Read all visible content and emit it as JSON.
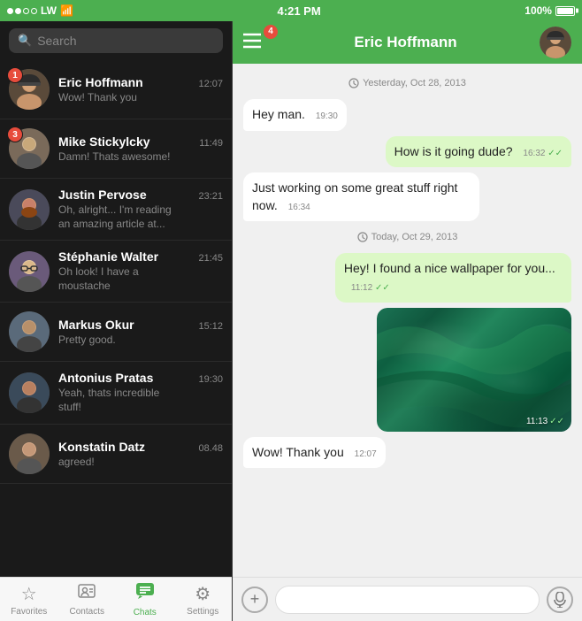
{
  "statusBar": {
    "carrier": "LW",
    "time": "4:21 PM",
    "battery": "100%"
  },
  "search": {
    "placeholder": "Search"
  },
  "chats": [
    {
      "id": 1,
      "name": "Eric Hoffmann",
      "time": "12:07",
      "preview": "Wow! Thank you",
      "badge": 1
    },
    {
      "id": 2,
      "name": "Mike Stickylcky",
      "time": "11:49",
      "preview": "Damn! Thats awesome!",
      "badge": 3
    },
    {
      "id": 3,
      "name": "Justin Pervose",
      "time": "23:21",
      "preview": "Oh, alright... I'm reading an amazing article at...",
      "badge": 0
    },
    {
      "id": 4,
      "name": "Stéphanie Walter",
      "time": "21:45",
      "preview": "Oh look! I have a moustache",
      "badge": 0
    },
    {
      "id": 5,
      "name": "Markus Okur",
      "time": "15:12",
      "preview": "Pretty good.",
      "badge": 0
    },
    {
      "id": 6,
      "name": "Antonius Pratas",
      "time": "19:30",
      "preview": "Yeah, thats incredible stuff!",
      "badge": 0
    },
    {
      "id": 7,
      "name": "Konstatin Datz",
      "time": "08.48",
      "preview": "agreed!",
      "badge": 0
    }
  ],
  "chatHeader": {
    "name": "Eric Hoffmann",
    "menuBadge": "4"
  },
  "messages": [
    {
      "type": "date",
      "text": "Yesterday, Oct 28, 2013"
    },
    {
      "type": "received",
      "text": "Hey man.",
      "time": "19:30"
    },
    {
      "type": "sent",
      "text": "How is it going dude?",
      "time": "16:32",
      "ticks": "✓✓"
    },
    {
      "type": "received",
      "text": "Just working on some great stuff right now.",
      "time": "16:34"
    },
    {
      "type": "date",
      "text": "Today, Oct 29, 2013"
    },
    {
      "type": "sent",
      "text": "Hey! I found a nice wallpaper for you...",
      "time": "11:12",
      "ticks": "✓✓"
    },
    {
      "type": "img-sent",
      "time": "11:13",
      "ticks": "✓✓"
    },
    {
      "type": "received",
      "text": "Wow! Thank you",
      "time": "12:07"
    }
  ],
  "tabs": [
    {
      "id": "favorites",
      "label": "Favorites",
      "icon": "☆"
    },
    {
      "id": "contacts",
      "label": "Contacts",
      "icon": "👤"
    },
    {
      "id": "chats",
      "label": "Chats",
      "icon": "💬"
    },
    {
      "id": "settings",
      "label": "Settings",
      "icon": "⚙"
    }
  ],
  "activeTab": "chats"
}
